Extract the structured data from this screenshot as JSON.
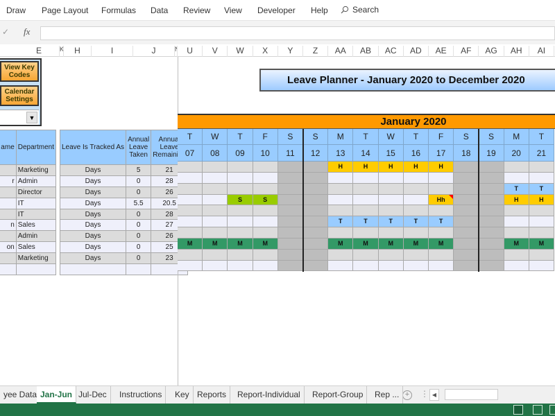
{
  "ribbon": {
    "tabs": [
      "Draw",
      "Page Layout",
      "Formulas",
      "Data",
      "Review",
      "View",
      "Developer",
      "Help"
    ],
    "search_label": "Search"
  },
  "formula_bar": {
    "fx_label": "fx",
    "value": ""
  },
  "column_headers": {
    "left": [
      "E",
      "K",
      "H",
      "I",
      "J",
      "N"
    ],
    "calendar": [
      "U",
      "V",
      "W",
      "X",
      "Y",
      "Z",
      "AA",
      "AB",
      "AC",
      "AD",
      "AE",
      "AF",
      "AG",
      "AH",
      "AI"
    ]
  },
  "controls": {
    "view_key_codes": "View Key Codes",
    "calendar_settings": "Calendar Settings",
    "dropdown_value": ""
  },
  "employee_table": {
    "headers": {
      "name": "ame",
      "department": "Department",
      "tracked": "Leave Is Tracked As",
      "taken": "Annual Leave Taken",
      "remaining": "Annual Leave Remaining"
    },
    "rows": [
      {
        "name": "",
        "department": "Marketing",
        "tracked": "Days",
        "taken": "5",
        "remaining": "21"
      },
      {
        "name": "r",
        "department": "Admin",
        "tracked": "Days",
        "taken": "0",
        "remaining": "28"
      },
      {
        "name": "",
        "department": "Director",
        "tracked": "Days",
        "taken": "0",
        "remaining": "26"
      },
      {
        "name": "",
        "department": "IT",
        "tracked": "Days",
        "taken": "5.5",
        "remaining": "20.5"
      },
      {
        "name": "",
        "department": "IT",
        "tracked": "Days",
        "taken": "0",
        "remaining": "28"
      },
      {
        "name": "n",
        "department": "Sales",
        "tracked": "Days",
        "taken": "0",
        "remaining": "27"
      },
      {
        "name": "",
        "department": "Admin",
        "tracked": "Days",
        "taken": "0",
        "remaining": "26"
      },
      {
        "name": "on",
        "department": "Sales",
        "tracked": "Days",
        "taken": "0",
        "remaining": "25"
      },
      {
        "name": "",
        "department": "Marketing",
        "tracked": "Days",
        "taken": "0",
        "remaining": "23"
      },
      {
        "name": "",
        "department": "",
        "tracked": "",
        "taken": "",
        "remaining": ""
      }
    ]
  },
  "calendar": {
    "title": "Leave Planner - January 2020 to December 2020",
    "month": "January 2020",
    "days": [
      {
        "dow": "T",
        "date": "07",
        "weekend": false
      },
      {
        "dow": "W",
        "date": "08",
        "weekend": false
      },
      {
        "dow": "T",
        "date": "09",
        "weekend": false
      },
      {
        "dow": "F",
        "date": "10",
        "weekend": false
      },
      {
        "dow": "S",
        "date": "11",
        "weekend": true
      },
      {
        "dow": "S",
        "date": "12",
        "weekend": true
      },
      {
        "dow": "M",
        "date": "13",
        "weekend": false
      },
      {
        "dow": "T",
        "date": "14",
        "weekend": false
      },
      {
        "dow": "W",
        "date": "15",
        "weekend": false
      },
      {
        "dow": "T",
        "date": "16",
        "weekend": false
      },
      {
        "dow": "F",
        "date": "17",
        "weekend": false
      },
      {
        "dow": "S",
        "date": "18",
        "weekend": true
      },
      {
        "dow": "S",
        "date": "19",
        "weekend": true
      },
      {
        "dow": "M",
        "date": "20",
        "weekend": false
      },
      {
        "dow": "T",
        "date": "21",
        "weekend": false
      }
    ],
    "leave_entries": [
      [
        "",
        "",
        "",
        "",
        "",
        "",
        "H",
        "H",
        "H",
        "H",
        "H",
        "",
        "",
        "",
        ""
      ],
      [
        "",
        "",
        "",
        "",
        "",
        "",
        "",
        "",
        "",
        "",
        "",
        "",
        "",
        "",
        ""
      ],
      [
        "",
        "",
        "",
        "",
        "",
        "",
        "",
        "",
        "",
        "",
        "",
        "",
        "",
        "T",
        "T"
      ],
      [
        "",
        "",
        "S",
        "S",
        "",
        "",
        "",
        "",
        "",
        "",
        "Hh",
        "",
        "",
        "H",
        "H"
      ],
      [
        "",
        "",
        "",
        "",
        "",
        "",
        "",
        "",
        "",
        "",
        "",
        "",
        "",
        "",
        ""
      ],
      [
        "",
        "",
        "",
        "",
        "",
        "",
        "T",
        "T",
        "T",
        "T",
        "T",
        "",
        "",
        "",
        ""
      ],
      [
        "",
        "",
        "",
        "",
        "",
        "",
        "",
        "",
        "",
        "",
        "",
        "",
        "",
        "",
        ""
      ],
      [
        "M",
        "M",
        "M",
        "M",
        "",
        "",
        "M",
        "M",
        "M",
        "M",
        "M",
        "",
        "",
        "M",
        "M"
      ],
      [
        "",
        "",
        "",
        "",
        "",
        "",
        "",
        "",
        "",
        "",
        "",
        "",
        "",
        "",
        ""
      ],
      [
        "",
        "",
        "",
        "",
        "",
        "",
        "",
        "",
        "",
        "",
        "",
        "",
        "",
        "",
        ""
      ]
    ],
    "code_colors": {
      "H": "#ffcc00",
      "Hh": "#ffcc00",
      "T": "#99ccff",
      "S": "#99cc00",
      "M": "#339966"
    },
    "comment_flag": {
      "row": 3,
      "col": 10,
      "color": "#ff0000"
    },
    "weekend_color": "#bdbdbd",
    "row_colors": [
      "#dcdcdc",
      "#eff0fb"
    ]
  },
  "sheet_tabs": {
    "tabs": [
      "yee Data",
      "Jan-Jun",
      "Jul-Dec",
      "Instructions",
      "Key",
      "Reports",
      "Report-Individual",
      "Report-Group",
      "Rep ..."
    ],
    "active": "Jan-Jun",
    "add_label": "+"
  }
}
